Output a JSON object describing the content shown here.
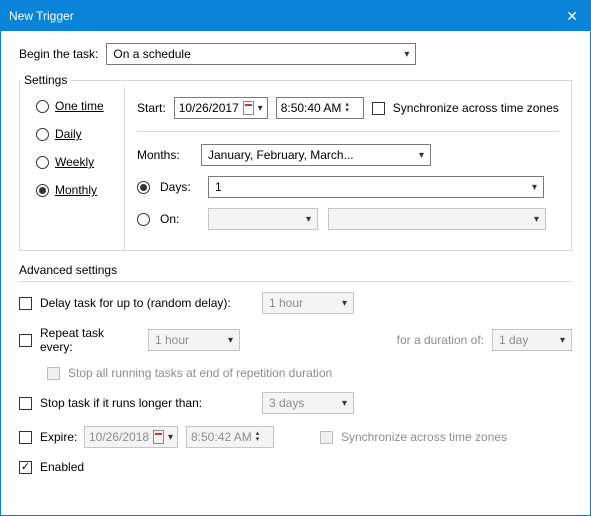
{
  "titlebar": {
    "title": "New Trigger"
  },
  "begin": {
    "label": "Begin the task:",
    "value": "On a schedule"
  },
  "settings": {
    "legend": "Settings",
    "radios": {
      "one_time": "One time",
      "daily": "Daily",
      "weekly": "Weekly",
      "monthly": "Monthly"
    },
    "start_label": "Start:",
    "start_date": "10/26/2017",
    "start_time": "8:50:40 AM",
    "sync_label": "Synchronize across time zones",
    "months_label": "Months:",
    "months_value": "January, February, March...",
    "days_label": "Days:",
    "days_value": "1",
    "on_label": "On:"
  },
  "advanced": {
    "legend": "Advanced settings",
    "delay_label": "Delay task for up to (random delay):",
    "delay_value": "1 hour",
    "repeat_label": "Repeat task every:",
    "repeat_value": "1 hour",
    "duration_label": "for a duration of:",
    "duration_value": "1 day",
    "stop_all_label": "Stop all running tasks at end of repetition duration",
    "stop_if_label": "Stop task if it runs longer than:",
    "stop_if_value": "3 days",
    "expire_label": "Expire:",
    "expire_date": "10/26/2018",
    "expire_time": "8:50:42 AM",
    "expire_sync": "Synchronize across time zones",
    "enabled_label": "Enabled"
  }
}
